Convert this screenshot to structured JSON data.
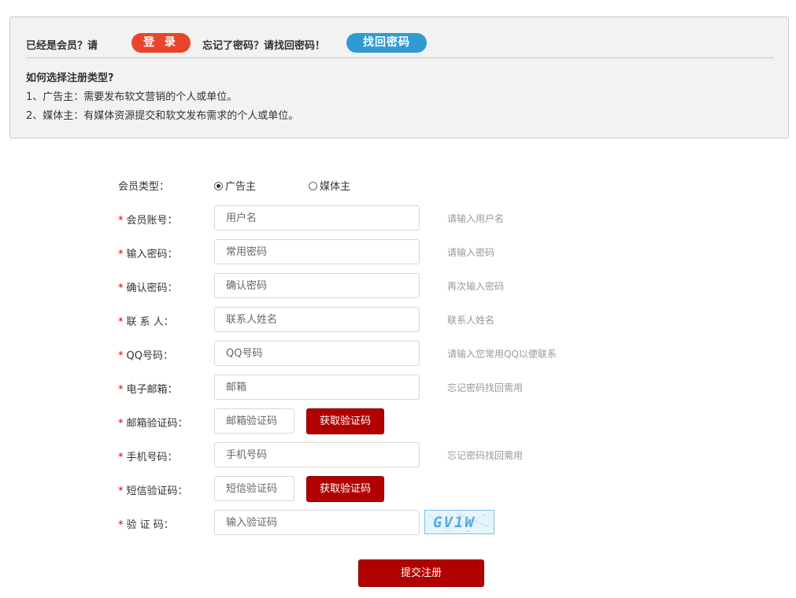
{
  "notice": {
    "already_member": "已经是会员？请",
    "login_button": "登 录",
    "forgot_text": "忘记了密码？请找回密码！",
    "recover_button": "找回密码",
    "question": "如何选择注册类型?",
    "items": [
      "1、广告主：需要发布软文营销的个人或单位。",
      "2、媒体主：有媒体资源提交和软文发布需求的个人或单位。"
    ]
  },
  "form": {
    "member_type": {
      "label": "会员类型：",
      "options": [
        "广告主",
        "媒体主"
      ],
      "selected": "广告主"
    },
    "account": {
      "star": "*",
      "label": "会员账号：",
      "placeholder": "用户名",
      "hint": "请输入用户名"
    },
    "password": {
      "star": "*",
      "label": "输入密码：",
      "placeholder": "常用密码",
      "hint": "请输入密码"
    },
    "confirm": {
      "star": "*",
      "label": "确认密码：",
      "placeholder": "确认密码",
      "hint": "再次输入密码"
    },
    "contact": {
      "star": "*",
      "label": "联 系 人：",
      "placeholder": "联系人姓名",
      "hint": "联系人姓名"
    },
    "qq": {
      "star": "*",
      "label": "QQ号码：",
      "placeholder": "QQ号码",
      "hint": "请输入您常用QQ以便联系"
    },
    "email": {
      "star": "*",
      "label": "电子邮箱：",
      "placeholder": "邮箱",
      "hint": "忘记密码找回需用"
    },
    "email_code": {
      "star": "*",
      "label": "邮箱验证码：",
      "placeholder": "邮箱验证码",
      "button": "获取验证码"
    },
    "phone": {
      "star": "*",
      "label": "手机号码：",
      "placeholder": "手机号码",
      "hint": "忘记密码找回需用"
    },
    "sms_code": {
      "star": "*",
      "label": "短信验证码：",
      "placeholder": "短信验证码",
      "button": "获取验证码"
    },
    "captcha": {
      "star": "*",
      "label": "验 证 码：",
      "placeholder": "输入验证码",
      "image_text": "GV1W"
    },
    "submit": "提交注册"
  }
}
